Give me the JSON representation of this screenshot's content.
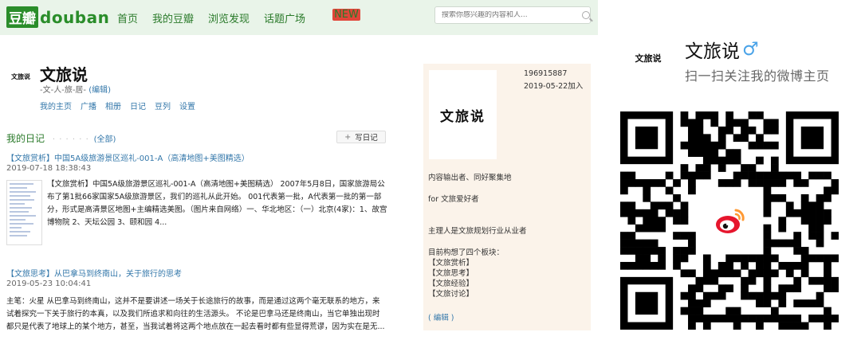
{
  "douban": {
    "logo": {
      "cn": "豆瓣",
      "en": "douban",
      "brand_color": "#2a8d2a"
    },
    "nav": [
      {
        "label": "首页"
      },
      {
        "label": "我的豆瓣"
      },
      {
        "label": "浏览发现"
      },
      {
        "label": "话题广场",
        "badge": "NEW"
      }
    ],
    "search": {
      "placeholder": "搜索你感兴趣的内容和人..."
    },
    "profile": {
      "avatar_text": "文旅说",
      "name": "文旅说",
      "tagline": "-文-人-旅-居-",
      "edit_label": "(编辑)",
      "tabs": [
        "我的主页",
        "广播",
        "相册",
        "日记",
        "豆列",
        "设置"
      ]
    },
    "diary": {
      "heading": "我的日记",
      "dots": "· · · · · ·",
      "all_label": "(全部)",
      "write_label": "写日记",
      "entries": [
        {
          "title": "【文旅赏析】中国5A级旅游景区巡礼-001-A（高清地图+美图精选）",
          "date": "2019-07-18 18:38:43",
          "body": "【文旅赏析】中国5A级旅游景区巡礼-001-A（高清地图+美图精选） 2007年5月8日，国家旅游局公布了第1批66家国家5A级旅游景区，我们的巡礼从此开始。 001代表第一批，A代表第一批的第一部分，形式是高清景区地图+主编精选美图。（图片来自网络）一、华北地区：（一）北京(4家)：1、故宫博物院 2、天坛公园 3、颐和园 4..."
        },
        {
          "title": "【文旅思考】从巴拿马到终南山，关于旅行的思考",
          "date": "2019-05-23 10:04:41",
          "body": "主笔：火星 从巴拿马到终南山，这并不是要讲述一场关于长途旅行的故事，而是通过这两个毫无联系的地方，来试着探究一下关于旅行的本真，以及我们所追求和向往的生活源头。 不论是巴拿马还是终南山，当它单独出现时都只是代表了地球上的某个地方，甚至，当我试着将这两个地点放在一起去看时都有些显得荒谬，因为实在是无..."
        }
      ]
    },
    "sidebar": {
      "avatar_text": "文旅说",
      "user_id": "196915887",
      "joined": "2019-05-22加入",
      "bio_lines": [
        "内容输出者、同好聚集地",
        "for 文旅爱好者",
        "主理人是文旅规划行业从业者",
        "目前构想了四个板块：",
        "【文旅赏析】",
        "【文旅思考】",
        "【文旅经验】",
        "【文旅讨论】"
      ],
      "edit_label": "( 编辑 )"
    }
  },
  "weibo": {
    "logo_text": "文旅说",
    "name": "文旅说",
    "gender_icon": "male-icon",
    "subtitle": "扫一扫关注我的微博主页",
    "logo_colors": {
      "red": "#e6162d",
      "orange": "#ff9933"
    }
  }
}
